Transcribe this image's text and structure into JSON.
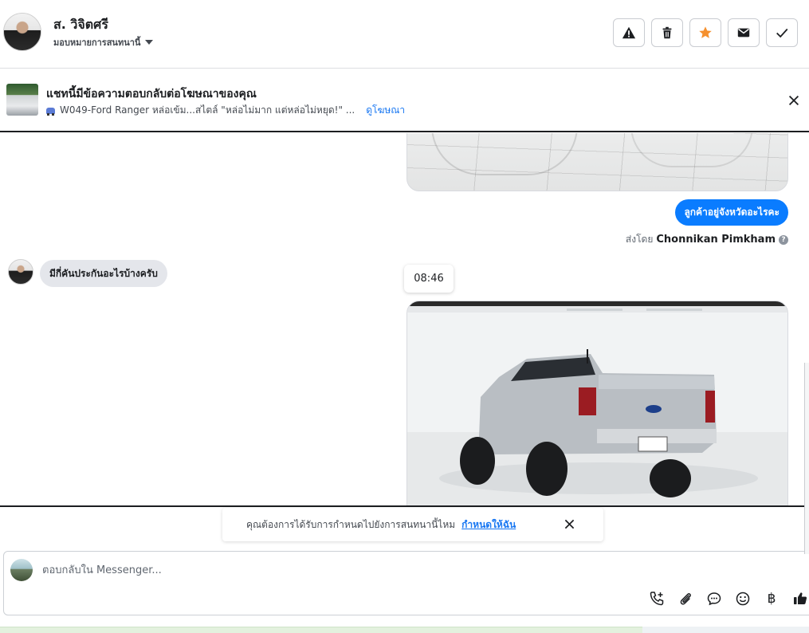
{
  "header": {
    "contact_name": "ส. วิจิตศรี",
    "assign_label": "มอบหมายการสนทนานี้",
    "actions": [
      "warning-icon",
      "trash-icon",
      "star-icon",
      "mail-icon",
      "check-icon"
    ],
    "star_color": "#f5902e"
  },
  "ad_reply": {
    "title": "แชทนี้มีข้อความตอบกลับต่อโฆษณาของคุณ",
    "ad_text": "W049-Ford Ranger หล่อเข้ม...สไตล์ \"หล่อไม่มาก แต่หล่อไม่หยุด!\" ...",
    "view_ad_link": "ดูโฆษณา"
  },
  "messages": {
    "outgoing_text": "ลูกค้าอยู่จังหวัดอะไรคะ",
    "sent_by_prefix": "ส่งโดย",
    "sent_by_name": "Chonnikan Pimkham",
    "incoming_text": "มีกี่คันประกันอะไรบ้างครับ",
    "time_chip": "08:46",
    "outgoing_color": "#0a7cff"
  },
  "schedule_prompt": {
    "text": "คุณต้องการได้รับการกำหนดไปยังการสนทนานี้ไหม",
    "link": "กำหนดให้ฉัน"
  },
  "composer": {
    "placeholder": "ตอบกลับใน Messenger...",
    "tools": [
      "phone-add-icon",
      "attachment-icon",
      "saved-reply-icon",
      "emoji-icon",
      "baht-payment-icon",
      "thumbs-up-icon"
    ],
    "baht_symbol": "฿"
  }
}
